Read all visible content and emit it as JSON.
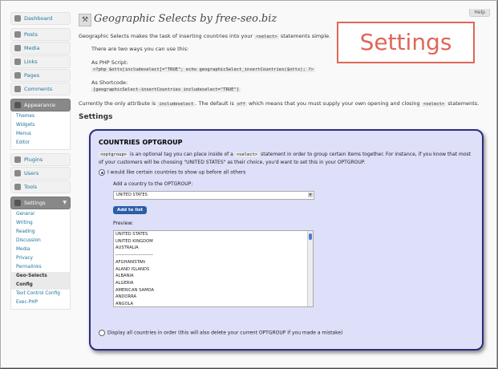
{
  "help_label": "Help",
  "sidebar": {
    "dashboard": "Dashboard",
    "group1": [
      "Posts",
      "Media",
      "Links",
      "Pages",
      "Comments"
    ],
    "appearance": "Appearance",
    "appearance_sub": [
      "Themes",
      "Widgets",
      "Menus",
      "Editor"
    ],
    "group3": [
      "Plugins",
      "Users",
      "Tools"
    ],
    "settings": "Settings",
    "settings_sub": [
      "General",
      "Writing",
      "Reading",
      "Discussion",
      "Media",
      "Privacy",
      "Permalinks",
      "Geo-Selects Config",
      "Text Control Config",
      "Exec-PHP"
    ]
  },
  "page": {
    "title": "Geographic Selects by free-seo.biz",
    "intro_pre": "Geographic Selects makes the task of inserting countries into your",
    "intro_code": "<select>",
    "intro_post": "statements simple.",
    "ways": "There are two ways you can use this:",
    "php_label": "As PHP Script:",
    "php_code": "<?php $otts[includeselect]=\"TRUE\"; echo geographicSelect_insertCountries($otts); ?>",
    "shortcode_label": "As Shortcode:",
    "shortcode_code": "[geographicSelect-insertCountries includeselect=\"TRUE\"]",
    "attr_pre": "Currently the only attribute is",
    "attr_code": "includeselect",
    "attr_mid": ". The default is",
    "attr_code2": "off",
    "attr_post": "which means that you must supply your own opening and closing",
    "attr_code3": "<select>",
    "attr_end": "statements.",
    "overlay": "Settings",
    "settings_heading": "Settings"
  },
  "box": {
    "title": "COUNTRIES OPTGROUP",
    "desc_code": "<optgroup>",
    "desc_a": "is an optional tag you can place inside of a",
    "desc_code2": "<select>",
    "desc_b": "statement in order to group certain items together. For instance, if you know that most of your customers will be choosing \"UNITED STATES\" as their choice, you'd want to set this in your OPTGROUP.",
    "radio1": "I would like certain countries to show up before all others",
    "add_label": "Add a country to the OPTGROUP:",
    "selected_country": "UNITED STATES",
    "add_button": "Add to list",
    "preview_label": "Preview:",
    "preview_items": [
      "UNITED STATES",
      "UNITED KINGDOM",
      "AUSTRALIA",
      "-------------------------",
      "AFGHANISTAN",
      "ALAND ISLANDS",
      "ALBANIA",
      "ALGERIA",
      "AMERICAN SAMOA",
      "ANDORRA",
      "ANGOLA"
    ],
    "radio2": "Display all countries in order (this will also delete your current OPTGROUP if you made a mistake)"
  }
}
